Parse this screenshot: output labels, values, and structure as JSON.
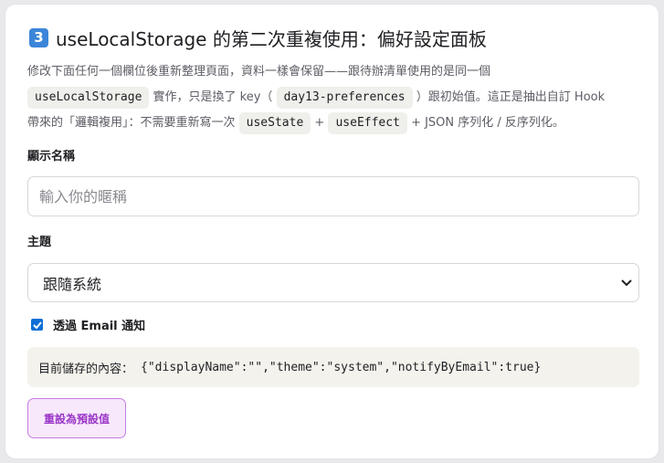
{
  "header": {
    "badge": "3",
    "title": "useLocalStorage 的第二次重複使用：偏好設定面板"
  },
  "description": {
    "line1": "修改下面任何一個欄位後重新整理頁面，資料一樣會保留——跟待辦清單使用的是同一個",
    "code1": "useLocalStorage",
    "text2": "實作，只是換了 key（",
    "code2": "day13-preferences",
    "text3": "）跟初始值。這正是抽出自訂 Hook",
    "text4": "帶來的「邏輯複用」：不需要重新寫一次",
    "code3": "useState",
    "text5": "+",
    "code4": "useEffect",
    "text6": "+ JSON 序列化 / 反序列化。"
  },
  "display_name": {
    "label": "顯示名稱",
    "value": "",
    "placeholder": "輸入你的暱稱"
  },
  "theme": {
    "label": "主題",
    "selected": "跟隨系統"
  },
  "notify": {
    "label": "透過 Email 通知",
    "checked": true
  },
  "storage": {
    "label": "目前儲存的內容：",
    "value": "{\"displayName\":\"\",\"theme\":\"system\",\"notifyByEmail\":true}"
  },
  "reset_button": {
    "label": "重設為預設值"
  },
  "colors": {
    "badge": "#3b86d9",
    "checkbox": "#0b6fd6",
    "reset_border": "#c77de3",
    "reset_bg": "#f8e8fb",
    "reset_text": "#9a37c7"
  },
  "icons": {
    "badge": "keycap-number-icon",
    "select": "chevron-down-icon",
    "checkbox": "checkmark-icon"
  }
}
